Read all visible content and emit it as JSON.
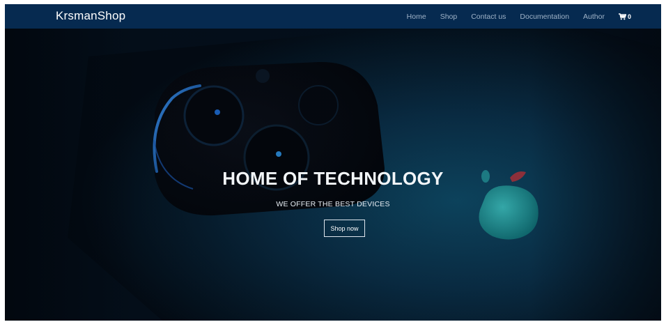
{
  "navbar": {
    "brand": "KrsmanShop",
    "links": [
      "Home",
      "Shop",
      "Contact us",
      "Documentation",
      "Author"
    ],
    "cart": {
      "icon": "cart-icon",
      "count": "0"
    }
  },
  "hero": {
    "title": "HOME OF TECHNOLOGY",
    "subtitle": "WE OFFER THE BEST DEVICES",
    "button_label": "Shop now",
    "image": "phone-camera-apple-logo-background"
  },
  "colors": {
    "navbar_bg": "#062a50",
    "hero_dark": "#04101c",
    "accent_blue": "#1e6fd9",
    "logo_teal": "#1ea7a8"
  }
}
